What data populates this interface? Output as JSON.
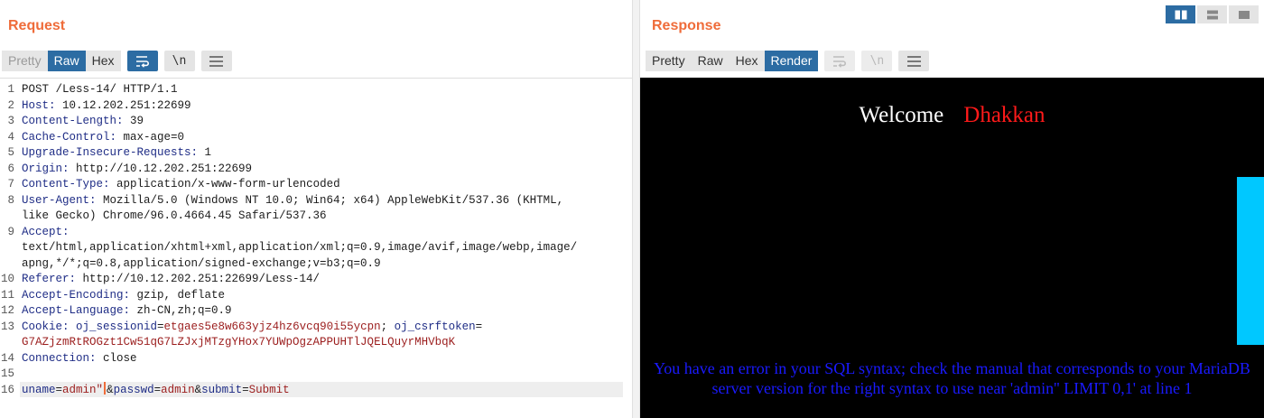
{
  "request": {
    "title": "Request",
    "tabs": [
      {
        "label": "Pretty",
        "state": "disabled"
      },
      {
        "label": "Raw",
        "state": "active"
      },
      {
        "label": "Hex",
        "state": "normal"
      }
    ],
    "icons": [
      {
        "name": "word-wrap-icon",
        "state": "active"
      },
      {
        "name": "newline-toggle-icon",
        "text": "\\n",
        "state": "normal"
      },
      {
        "name": "menu-icon",
        "state": "normal"
      }
    ],
    "lines": [
      {
        "n": "1",
        "parts": [
          {
            "t": "POST /Less-14/ HTTP/1.1",
            "c": "v"
          }
        ]
      },
      {
        "n": "2",
        "parts": [
          {
            "t": "Host: ",
            "c": "k"
          },
          {
            "t": "10.12.202.251:22699",
            "c": "v"
          }
        ]
      },
      {
        "n": "3",
        "parts": [
          {
            "t": "Content-Length: ",
            "c": "k"
          },
          {
            "t": "39",
            "c": "v"
          }
        ]
      },
      {
        "n": "4",
        "parts": [
          {
            "t": "Cache-Control: ",
            "c": "k"
          },
          {
            "t": "max-age=0",
            "c": "v"
          }
        ]
      },
      {
        "n": "5",
        "parts": [
          {
            "t": "Upgrade-Insecure-Requests: ",
            "c": "k"
          },
          {
            "t": "1",
            "c": "v"
          }
        ]
      },
      {
        "n": "6",
        "parts": [
          {
            "t": "Origin: ",
            "c": "k"
          },
          {
            "t": "http://10.12.202.251:22699",
            "c": "v"
          }
        ]
      },
      {
        "n": "7",
        "parts": [
          {
            "t": "Content-Type: ",
            "c": "k"
          },
          {
            "t": "application/x-www-form-urlencoded",
            "c": "v"
          }
        ]
      },
      {
        "n": "8",
        "parts": [
          {
            "t": "User-Agent: ",
            "c": "k"
          },
          {
            "t": "Mozilla/5.0 (Windows NT 10.0; Win64; x64) AppleWebKit/537.36 (KHTML,",
            "c": "v"
          }
        ]
      },
      {
        "n": "",
        "parts": [
          {
            "t": "like Gecko) Chrome/96.0.4664.45 Safari/537.36",
            "c": "v"
          }
        ]
      },
      {
        "n": "9",
        "parts": [
          {
            "t": "Accept:",
            "c": "k"
          }
        ]
      },
      {
        "n": "",
        "parts": [
          {
            "t": "text/html,application/xhtml+xml,application/xml;q=0.9,image/avif,image/webp,image/",
            "c": "v"
          }
        ]
      },
      {
        "n": "",
        "parts": [
          {
            "t": "apng,*/*;q=0.8,application/signed-exchange;v=b3;q=0.9",
            "c": "v"
          }
        ]
      },
      {
        "n": "10",
        "parts": [
          {
            "t": "Referer: ",
            "c": "k"
          },
          {
            "t": "http://10.12.202.251:22699/Less-14/",
            "c": "v"
          }
        ]
      },
      {
        "n": "11",
        "parts": [
          {
            "t": "Accept-Encoding: ",
            "c": "k"
          },
          {
            "t": "gzip, deflate",
            "c": "v"
          }
        ]
      },
      {
        "n": "12",
        "parts": [
          {
            "t": "Accept-Language: ",
            "c": "k"
          },
          {
            "t": "zh-CN,zh;q=0.9",
            "c": "v"
          }
        ]
      },
      {
        "n": "13",
        "parts": [
          {
            "t": "Cookie: ",
            "c": "k"
          },
          {
            "t": "oj_sessionid",
            "c": "k"
          },
          {
            "t": "=",
            "c": "v"
          },
          {
            "t": "etgaes5e8w663yjz4hz6vcq90i55ycpn",
            "c": "cv"
          },
          {
            "t": "; ",
            "c": "v"
          },
          {
            "t": "oj_csrftoken",
            "c": "k"
          },
          {
            "t": "=",
            "c": "v"
          }
        ]
      },
      {
        "n": "",
        "parts": [
          {
            "t": "G7AZjzmRtROGzt1Cw51qG7LZJxjMTzgYHox7YUWpOgzAPPUHTlJQELQuyrMHVbqK",
            "c": "cv"
          }
        ]
      },
      {
        "n": "14",
        "parts": [
          {
            "t": "Connection: ",
            "c": "k"
          },
          {
            "t": "close",
            "c": "v"
          }
        ]
      },
      {
        "n": "15",
        "parts": []
      },
      {
        "n": "16",
        "current": true,
        "parts": [
          {
            "t": "uname",
            "c": "k"
          },
          {
            "t": "=",
            "c": "v"
          },
          {
            "t": "admin\"",
            "c": "cv"
          },
          {
            "caret": true
          },
          {
            "t": "&",
            "c": "v"
          },
          {
            "t": "passwd",
            "c": "k"
          },
          {
            "t": "=",
            "c": "v"
          },
          {
            "t": "admin",
            "c": "cv"
          },
          {
            "t": "&",
            "c": "v"
          },
          {
            "t": "submit",
            "c": "k"
          },
          {
            "t": "=",
            "c": "v"
          },
          {
            "t": "Submit",
            "c": "cv"
          }
        ]
      }
    ]
  },
  "response": {
    "title": "Response",
    "tabs": [
      {
        "label": "Pretty",
        "state": "normal"
      },
      {
        "label": "Raw",
        "state": "normal"
      },
      {
        "label": "Hex",
        "state": "normal"
      },
      {
        "label": "Render",
        "state": "active"
      }
    ],
    "icons": [
      {
        "name": "word-wrap-icon",
        "state": "disabled"
      },
      {
        "name": "newline-toggle-icon",
        "text": "\\n",
        "state": "disabled"
      },
      {
        "name": "menu-icon",
        "state": "normal"
      }
    ],
    "render": {
      "welcome": "Welcome",
      "name": "Dhakkan",
      "error": "You have an error in your SQL syntax; check the manual that corresponds to your MariaDB server version for the right syntax to use near 'admin'' LIMIT 0,1' at line 1"
    }
  },
  "layout_switch": [
    {
      "name": "layout-side-by-side-icon",
      "state": "active"
    },
    {
      "name": "layout-top-bottom-icon",
      "state": "normal"
    },
    {
      "name": "layout-tabs-icon",
      "state": "normal"
    }
  ]
}
